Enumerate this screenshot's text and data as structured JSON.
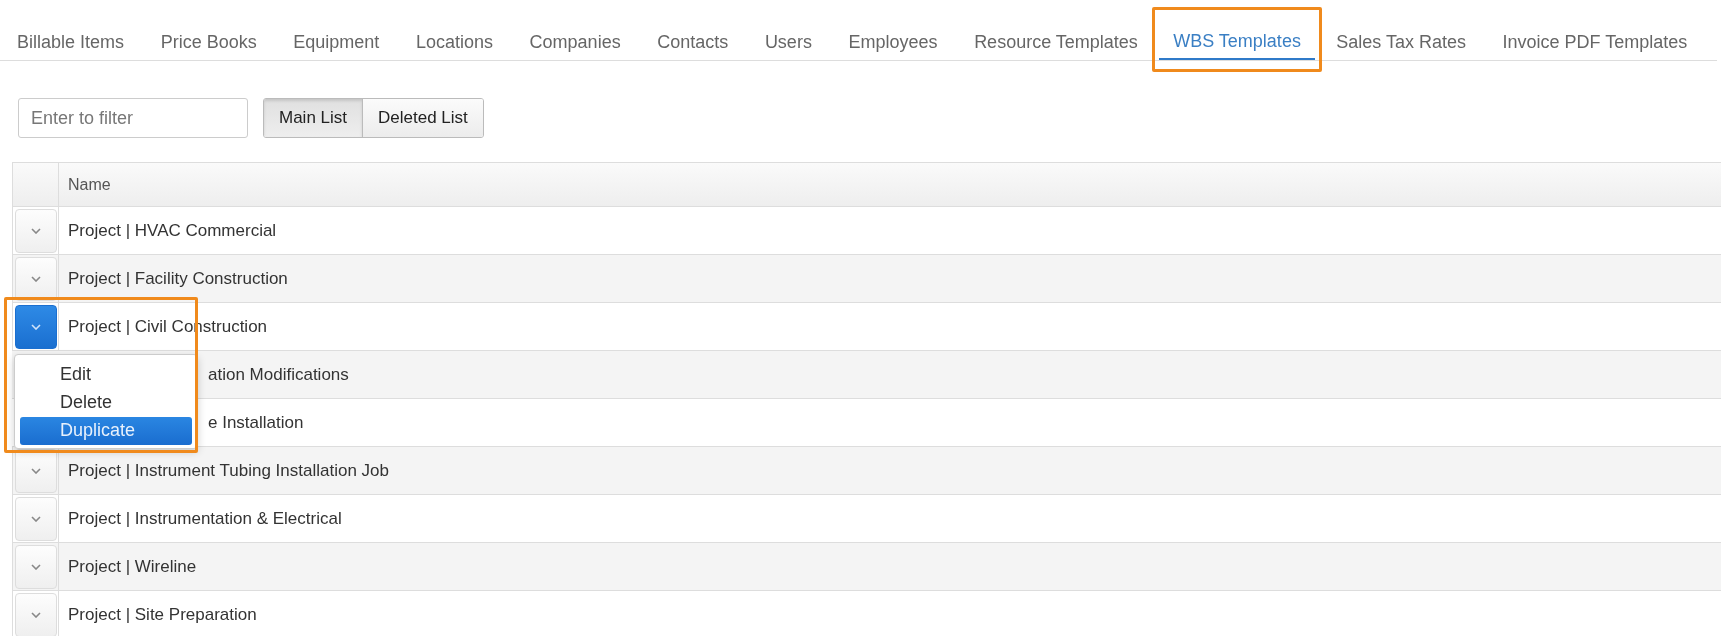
{
  "tabs": [
    {
      "label": "Billable Items",
      "selected": false,
      "highlighted": false
    },
    {
      "label": "Price Books",
      "selected": false,
      "highlighted": false
    },
    {
      "label": "Equipment",
      "selected": false,
      "highlighted": false
    },
    {
      "label": "Locations",
      "selected": false,
      "highlighted": false
    },
    {
      "label": "Companies",
      "selected": false,
      "highlighted": false
    },
    {
      "label": "Contacts",
      "selected": false,
      "highlighted": false
    },
    {
      "label": "Users",
      "selected": false,
      "highlighted": false
    },
    {
      "label": "Employees",
      "selected": false,
      "highlighted": false
    },
    {
      "label": "Resource Templates",
      "selected": false,
      "highlighted": false
    },
    {
      "label": "WBS Templates",
      "selected": true,
      "highlighted": true
    },
    {
      "label": "Sales Tax Rates",
      "selected": false,
      "highlighted": false
    },
    {
      "label": "Invoice PDF Templates",
      "selected": false,
      "highlighted": false
    }
  ],
  "filter": {
    "placeholder": "Enter to filter"
  },
  "list_toggle": [
    {
      "label": "Main List",
      "selected": true
    },
    {
      "label": "Deleted List",
      "selected": false
    }
  ],
  "table": {
    "columns": [
      "Name"
    ],
    "rows": [
      {
        "name": "Project | HVAC Commercial",
        "expanded": false,
        "highlighted": false
      },
      {
        "name": "Project | Facility Construction",
        "expanded": false,
        "highlighted": false
      },
      {
        "name": "Project | Civil Construction",
        "expanded": true,
        "highlighted": true
      },
      {
        "name": "ation Modifications",
        "expanded": false,
        "highlighted": false
      },
      {
        "name": "e Installation",
        "expanded": false,
        "highlighted": false
      },
      {
        "name": "Project | Instrument Tubing Installation Job",
        "expanded": false,
        "highlighted": false
      },
      {
        "name": "Project | Instrumentation & Electrical",
        "expanded": false,
        "highlighted": false
      },
      {
        "name": "Project | Wireline",
        "expanded": false,
        "highlighted": false
      },
      {
        "name": "Project | Site Preparation",
        "expanded": false,
        "highlighted": false
      }
    ]
  },
  "row_menu": [
    {
      "label": "Edit",
      "selected": false
    },
    {
      "label": "Delete",
      "selected": false
    },
    {
      "label": "Duplicate",
      "selected": true
    }
  ]
}
